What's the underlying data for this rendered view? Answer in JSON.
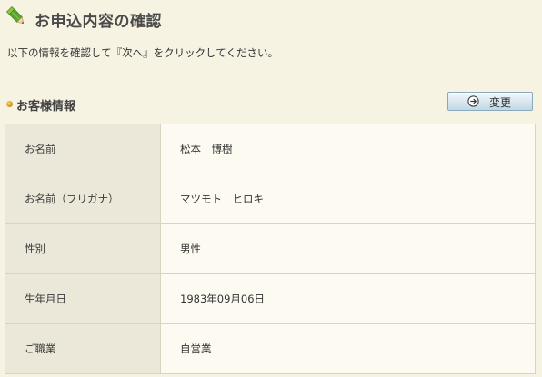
{
  "header": {
    "title": "お申込内容の確認",
    "icon": "pencil-icon"
  },
  "intro": {
    "text": "以下の情報を確認して『次へ』をクリックしてください。"
  },
  "section": {
    "title": "お客様情報",
    "bullet_color": "#d79c1c",
    "change_button_label": "変更",
    "change_button_icon": "circle-arrow-right-icon"
  },
  "customer_info": {
    "rows": [
      {
        "label": "お名前",
        "value": "松本　博樹"
      },
      {
        "label": "お名前（フリガナ）",
        "value": "マツモト　ヒロキ"
      },
      {
        "label": "性別",
        "value": "男性"
      },
      {
        "label": "生年月日",
        "value": "1983年09月06日"
      },
      {
        "label": "ご職業",
        "value": "自営業"
      }
    ]
  },
  "colors": {
    "background": "#f6f3e3",
    "label_cell": "#ece8d9",
    "value_cell": "#fdfbf1",
    "border": "#d9d4c2",
    "button_border": "#8aa9bd"
  }
}
